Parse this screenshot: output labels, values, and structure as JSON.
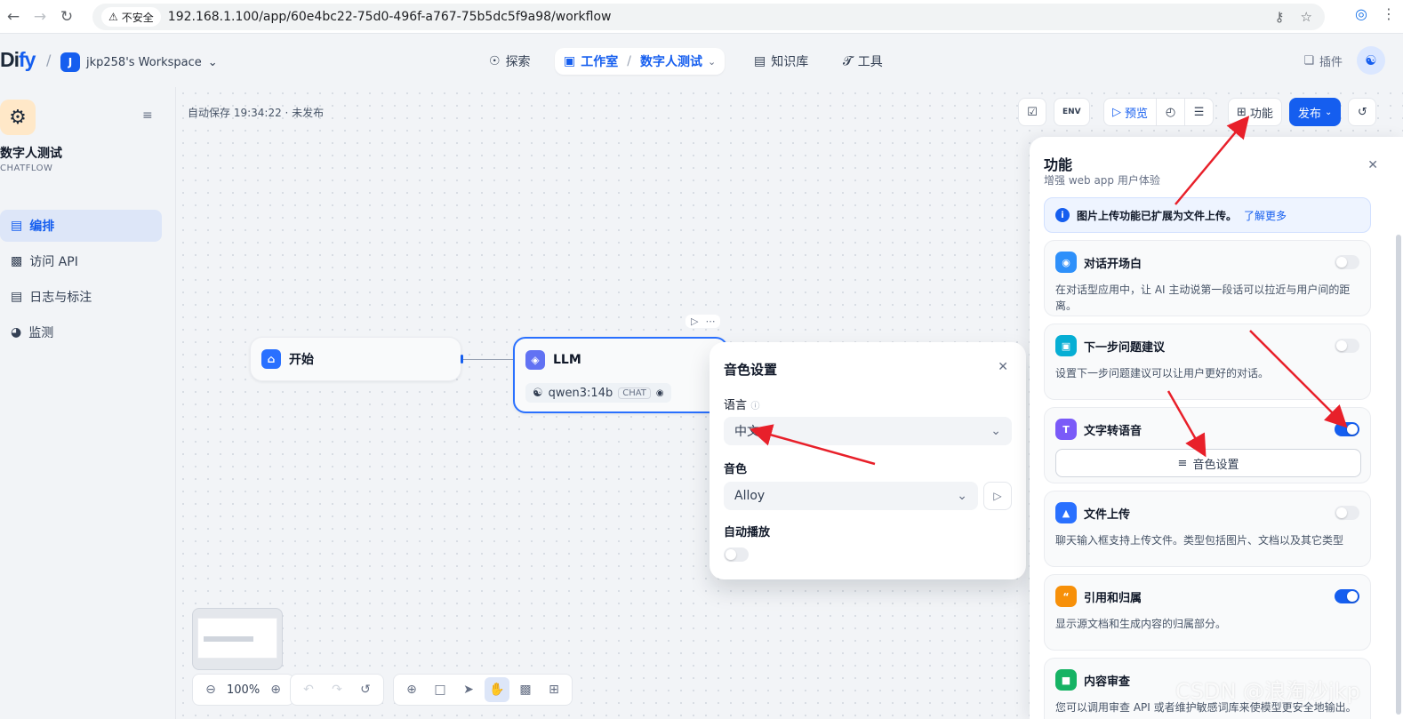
{
  "browser": {
    "insecure_label": "不安全",
    "url": "192.168.1.100/app/60e4bc22-75d0-496f-a767-75b5dc5f9a98/workflow"
  },
  "header": {
    "logo_main": "Di",
    "logo_accent": "fy",
    "workspace_initial": "J",
    "workspace_name": "jkp258's Workspace",
    "nav": {
      "explore": "探索",
      "studio": "工作室",
      "current_app": "数字人测试",
      "knowledge": "知识库",
      "tools": "工具"
    },
    "plugins": "插件"
  },
  "sidebar": {
    "app_name": "数字人测试",
    "app_type": "CHATFLOW",
    "items": [
      {
        "label": "编排"
      },
      {
        "label": "访问 API"
      },
      {
        "label": "日志与标注"
      },
      {
        "label": "监测"
      }
    ]
  },
  "canvas": {
    "autosave": "自动保存 19:34:22 · 未发布",
    "toolbar": {
      "env": "ENV",
      "preview": "预览",
      "features": "功能",
      "publish": "发布"
    },
    "nodes": {
      "start": "开始",
      "llm": "LLM",
      "model": "qwen3:14b",
      "model_tag": "CHAT"
    },
    "zoom": "100%"
  },
  "voice_modal": {
    "title": "音色设置",
    "language_label": "语言",
    "language_value": "中文",
    "voice_label": "音色",
    "voice_value": "Alloy",
    "autoplay_label": "自动播放"
  },
  "features_panel": {
    "title": "功能",
    "subtitle": "增强 web app 用户体验",
    "info": "图片上传功能已扩展为文件上传。",
    "info_link": "了解更多",
    "cards": [
      {
        "title": "对话开场白",
        "desc": "在对话型应用中，让 AI 主动说第一段话可以拉近与用户间的距离。"
      },
      {
        "title": "下一步问题建议",
        "desc": "设置下一步问题建议可以让用户更好的对话。"
      },
      {
        "title": "文字转语音",
        "button": "音色设置"
      },
      {
        "title": "文件上传",
        "desc": "聊天输入框支持上传文件。类型包括图片、文档以及其它类型"
      },
      {
        "title": "引用和归属",
        "desc": "显示源文档和生成内容的归属部分。"
      },
      {
        "title": "内容审查",
        "desc": "您可以调用审查 API 或者维护敏感词库来使模型更安全地输出。"
      }
    ]
  },
  "watermark": "CSDN @浪淘沙jkp",
  "colors": {
    "primary": "#155eef",
    "annotation": "#e8202a"
  }
}
